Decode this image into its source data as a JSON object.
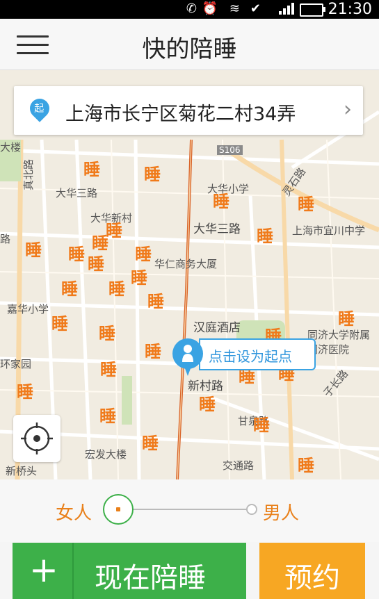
{
  "status_bar": {
    "time": "21:30",
    "icons": [
      "phone-icon",
      "alarm-icon",
      "wifi-icon",
      "3g-icon",
      "check-icon",
      "signal-icon",
      "battery-icon"
    ]
  },
  "header": {
    "title": "快的陪睡",
    "menu_icon": "hamburger-icon"
  },
  "address": {
    "pin_label": "起",
    "text": "上海市长宁区菊花二村34弄",
    "chevron": "chevron-right-icon"
  },
  "map": {
    "start_tooltip": "点击设为起点",
    "sleep_marker": "睡",
    "labels": {
      "dalou": "大楼",
      "daxing_road": "大华三路",
      "dahua_xincun": "大华新村",
      "dahua_school": "大华小学",
      "dahua_3rd_station": "大华三路",
      "s106": "S106",
      "lingshi_road": "灵石路",
      "shanghai_school": "上海市宜川中学",
      "zhenbei_road": "真北路",
      "huaren_dasha": "华仁商务大厦",
      "jiahua_school": "嘉华小学",
      "hanting_hotel": "汉庭酒店",
      "tongji_hospital": "同济大学附属同济医院",
      "huanjiayuan": "环家园",
      "xincun_road": "新村路",
      "hongfa_dasha": "宏发大楼",
      "xinqiaotou": "新桥头",
      "jiaotong_road": "交通路",
      "ganquan_road": "甘泉路",
      "zichang_road": "子长路",
      "lu_left": "路"
    },
    "colors": {
      "road_major": "#f5c89a",
      "road_metro": "#d9652a",
      "pin": "#3aa3e3",
      "sleep": "#f07a1a"
    }
  },
  "gender": {
    "female": "女人",
    "male": "男人",
    "selected": "female"
  },
  "actions": {
    "plus_label": "+",
    "now_label": "现在陪睡",
    "book_label": "预约"
  }
}
